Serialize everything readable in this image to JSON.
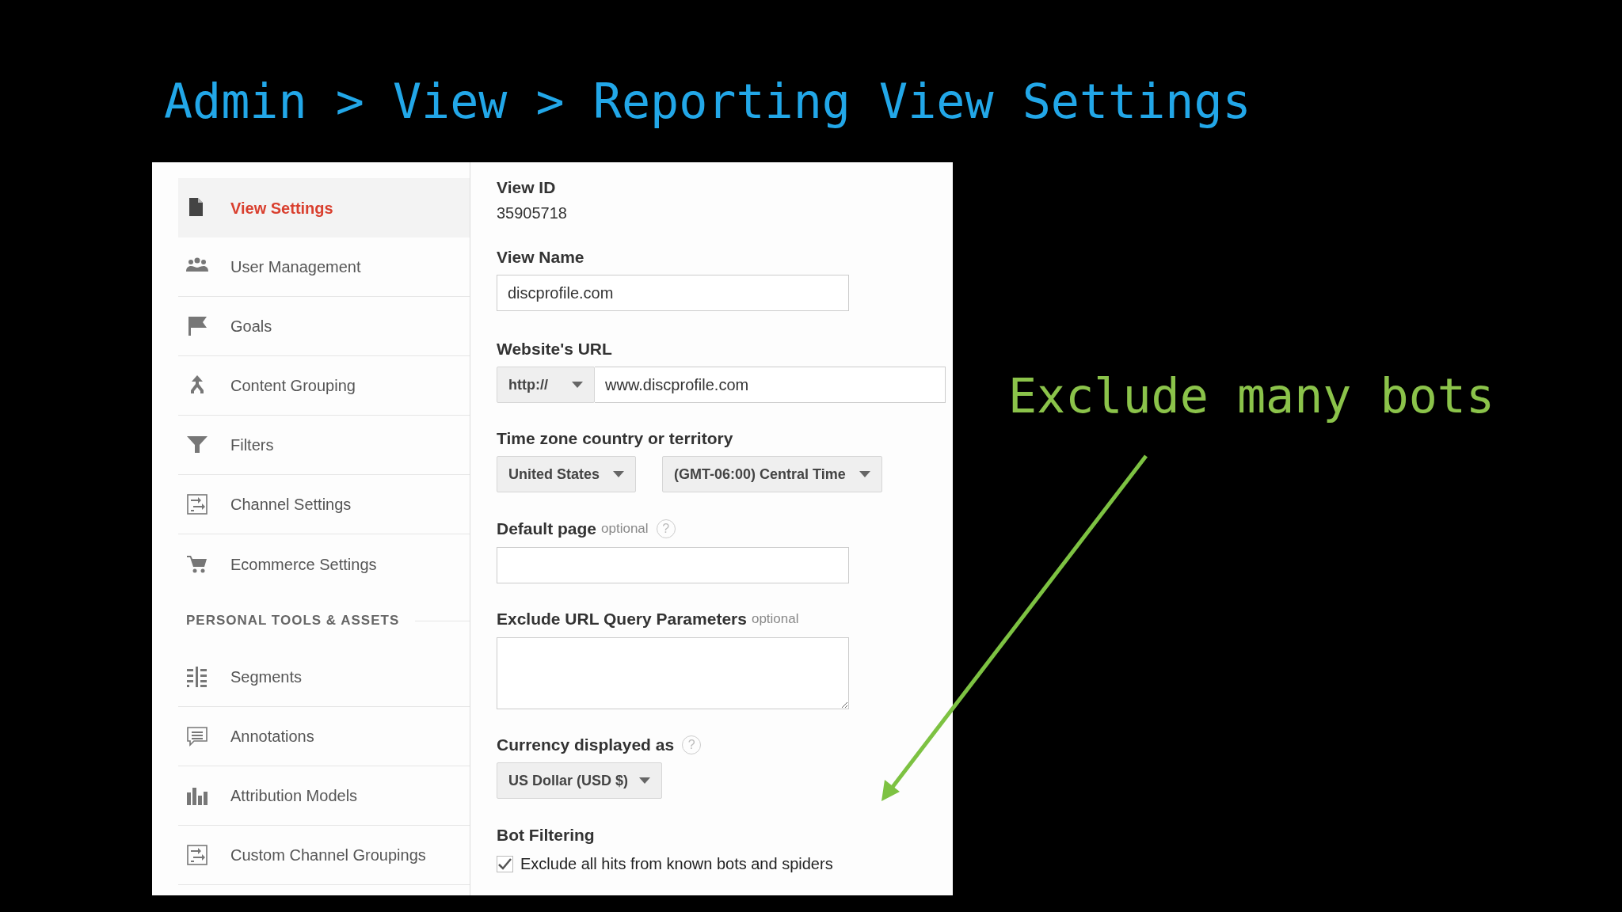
{
  "heading": "Admin > View > Reporting View Settings",
  "sidebar": {
    "items": [
      {
        "label": "View Settings",
        "selected": true
      },
      {
        "label": "User Management",
        "selected": false
      },
      {
        "label": "Goals",
        "selected": false
      },
      {
        "label": "Content Grouping",
        "selected": false
      },
      {
        "label": "Filters",
        "selected": false
      },
      {
        "label": "Channel Settings",
        "selected": false
      },
      {
        "label": "Ecommerce Settings",
        "selected": false
      }
    ],
    "section_heading": "PERSONAL TOOLS & ASSETS",
    "section_items": [
      {
        "label": "Segments",
        "selected": false
      },
      {
        "label": "Annotations",
        "selected": false
      },
      {
        "label": "Attribution Models",
        "selected": false
      },
      {
        "label": "Custom Channel Groupings",
        "selected": false
      }
    ]
  },
  "form": {
    "view_id": {
      "label": "View ID",
      "value": "35905718"
    },
    "view_name": {
      "label": "View Name",
      "value": "discprofile.com"
    },
    "website_url": {
      "label": "Website's URL",
      "protocol": "http://",
      "value": "www.discprofile.com"
    },
    "time_zone": {
      "label": "Time zone country or territory",
      "country": "United States",
      "zone": "(GMT-06:00) Central Time"
    },
    "default_page": {
      "label": "Default page",
      "note": "optional",
      "help": "?"
    },
    "exclude_params": {
      "label": "Exclude URL Query Parameters",
      "note": "optional"
    },
    "currency": {
      "label": "Currency displayed as",
      "help": "?",
      "value": "US Dollar (USD $)"
    },
    "bot_filtering": {
      "label": "Bot Filtering",
      "option": "Exclude all hits from known bots and spiders",
      "checked": true
    }
  },
  "annotation": {
    "text": "Exclude many bots"
  }
}
